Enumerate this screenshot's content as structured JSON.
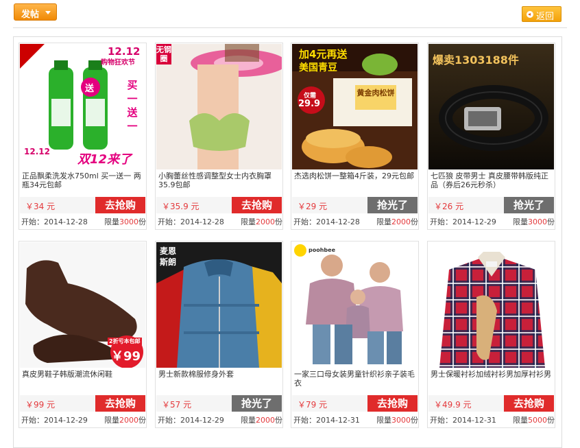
{
  "toolbar": {
    "post_label": "发帖",
    "back_label": "返回"
  },
  "colors": {
    "accent_orange": "#f39800",
    "buy_red": "#e02b2b",
    "sold_gray": "#6e6e6e",
    "price_red": "#e4393c"
  },
  "products": [
    {
      "title": "正品飘柔洗发水750ml 买一送一 两瓶34元包邮",
      "price": "￥34 元",
      "button": "去抢购",
      "status": "available",
      "start_label": "开始：",
      "start_date": "2014-12-28",
      "limit_prefix": "限量",
      "limit_qty": "3000",
      "limit_unit": "份",
      "image_texts": [
        "12.12",
        "购物狂欢节",
        "送",
        "买一送一",
        "12.12",
        "双12来了"
      ]
    },
    {
      "title": "小胸蕾丝性感调整型女士内衣胸罩 35.9包邮",
      "price": "￥35.9 元",
      "button": "去抢购",
      "status": "available",
      "start_label": "开始：",
      "start_date": "2014-12-28",
      "limit_prefix": "限量",
      "limit_qty": "2000",
      "limit_unit": "份",
      "image_texts": [
        "无钢圈"
      ]
    },
    {
      "title": "杰选肉松饼一整箱4斤装，29元包邮",
      "price": "￥29 元",
      "button": "抢光了",
      "status": "sold-out",
      "start_label": "开始：",
      "start_date": "2014-12-28",
      "limit_prefix": "限量",
      "limit_qty": "2000",
      "limit_unit": "份",
      "image_texts": [
        "加4元再送",
        "美国青豆",
        "仅需",
        "29.9",
        "黄金肉松饼"
      ]
    },
    {
      "title": "七匹狼 皮带男士 真皮腰带韩版纯正品（券后26元秒杀）",
      "price": "￥26 元",
      "button": "抢光了",
      "status": "sold-out",
      "start_label": "开始：",
      "start_date": "2014-12-29",
      "limit_prefix": "限量",
      "limit_qty": "3000",
      "limit_unit": "份",
      "image_texts": [
        "爆卖1303188件"
      ]
    },
    {
      "title": "真皮男鞋子韩版潮流休闲鞋",
      "price": "￥99 元",
      "button": "去抢购",
      "status": "available",
      "start_label": "开始：",
      "start_date": "2014-12-29",
      "limit_prefix": "限量",
      "limit_qty": "2000",
      "limit_unit": "份",
      "image_texts": [
        "2折亏本包邮",
        "￥99"
      ]
    },
    {
      "title": "男士新款棉服修身外套",
      "price": "￥57 元",
      "button": "抢光了",
      "status": "sold-out",
      "start_label": "开始：",
      "start_date": "2014-12-29",
      "limit_prefix": "限量",
      "limit_qty": "2000",
      "limit_unit": "份",
      "image_texts": [
        "麦恩",
        "斯朗"
      ]
    },
    {
      "title": "一家三口母女装男童针织衫亲子装毛衣",
      "price": "￥79 元",
      "button": "去抢购",
      "status": "available",
      "start_label": "开始：",
      "start_date": "2014-12-31",
      "limit_prefix": "限量",
      "limit_qty": "3000",
      "limit_unit": "份",
      "image_texts": [
        "poohbee"
      ]
    },
    {
      "title": "男士保暖衬衫加绒衬衫男加厚衬衫男",
      "price": "￥49.9 元",
      "button": "去抢购",
      "status": "available",
      "start_label": "开始：",
      "start_date": "2014-12-31",
      "limit_prefix": "限量",
      "limit_qty": "5000",
      "limit_unit": "份",
      "image_texts": []
    }
  ]
}
